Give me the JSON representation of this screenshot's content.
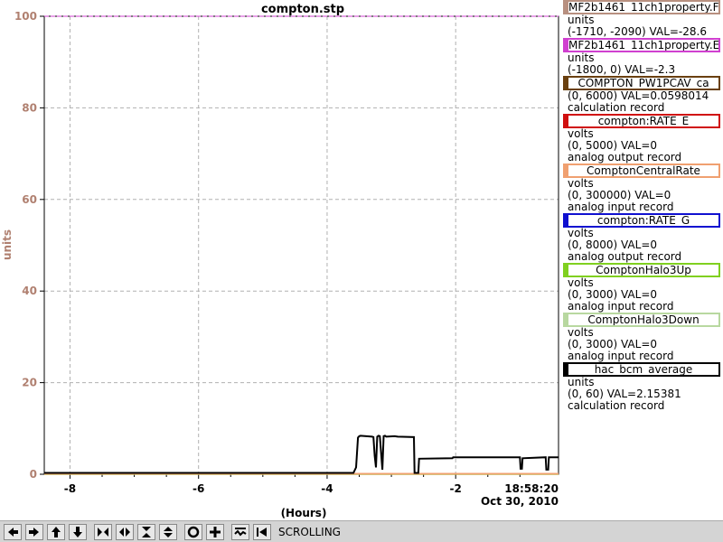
{
  "chart_data": {
    "type": "line",
    "title": "compton.stp",
    "xlabel": "(Hours)",
    "ylabel": "units",
    "xlim": [
      -8.4,
      -0.4
    ],
    "ylim": [
      0,
      100
    ],
    "x_ticks": [
      -8,
      -6,
      -4,
      -2
    ],
    "x_tick_labels": [
      "-8",
      "-6",
      "-4",
      "-2"
    ],
    "y_ticks": [
      0,
      20,
      40,
      60,
      80,
      100
    ],
    "y_tick_labels": [
      "0",
      "20",
      "40",
      "60",
      "80",
      "100"
    ],
    "grid": true,
    "timestamp_time": "18:58:20",
    "timestamp_date": "Oct 30, 2010",
    "series": [
      {
        "name": "hac_bcm_average",
        "color": "#000000",
        "x": [
          -8.4,
          -3.59,
          -3.55,
          -3.52,
          -3.5,
          -3.48,
          -3.3,
          -3.28,
          -3.26,
          -3.24,
          -3.22,
          -3.2,
          -3.18,
          -3.14,
          -3.12,
          -3.1,
          -3.08,
          -2.95,
          -2.9,
          -2.65,
          -2.64,
          -2.58,
          -2.57,
          -2.05,
          -2.04,
          -1.0,
          -0.99,
          -0.97,
          -0.96,
          -0.6,
          -0.59,
          -0.56,
          -0.55,
          -0.4
        ],
        "values": [
          0.3,
          0.3,
          1.5,
          8.0,
          8.3,
          8.4,
          8.2,
          8.1,
          4.0,
          1.5,
          8.2,
          8.4,
          8.3,
          1.0,
          8.3,
          8.4,
          8.2,
          8.3,
          8.2,
          8.1,
          0.3,
          0.3,
          3.4,
          3.5,
          3.7,
          3.7,
          1.2,
          1.2,
          3.5,
          3.7,
          1.0,
          1.0,
          3.7,
          3.7
        ]
      },
      {
        "name": "ComptonCentralRate",
        "color": "#f0a070",
        "x": [
          -8.4,
          -0.4
        ],
        "values": [
          0.1,
          0.1
        ]
      },
      {
        "name": "ComptonHalo3Up",
        "color": "#80d020",
        "x": [
          -8.4,
          -0.4
        ],
        "values": [
          0.05,
          0.05
        ]
      }
    ],
    "reference_line": {
      "value": 100,
      "color": "#d040d0"
    }
  },
  "legend": [
    {
      "name": "MF2b1461_11ch1property.F",
      "color": "#b89080",
      "lines": [
        "units",
        "(-1710, -2090) VAL=-28.6"
      ]
    },
    {
      "name": "MF2b1461_11ch1property.E",
      "color": "#d040d0",
      "lines": [
        "units",
        "(-1800, 0) VAL=-2.3"
      ]
    },
    {
      "name": "COMPTON_PW1PCAV_ca",
      "color": "#6a4010",
      "lines": [
        "(0, 6000) VAL=0.0598014",
        "calculation record"
      ]
    },
    {
      "name": "compton:RATE_E",
      "color": "#d01010",
      "lines": [
        "volts",
        "(0, 5000) VAL=0",
        "analog output record"
      ]
    },
    {
      "name": "ComptonCentralRate",
      "color": "#f0a070",
      "lines": [
        "volts",
        "(0, 300000) VAL=0",
        "analog input record"
      ]
    },
    {
      "name": "compton:RATE_G",
      "color": "#1010d0",
      "lines": [
        "volts",
        "(0, 8000) VAL=0",
        "analog output record"
      ]
    },
    {
      "name": "ComptonHalo3Up",
      "color": "#80d020",
      "lines": [
        "volts",
        "(0, 3000) VAL=0",
        "analog input record"
      ]
    },
    {
      "name": "ComptonHalo3Down",
      "color": "#b8d8a0",
      "lines": [
        "volts",
        "(0, 3000) VAL=0",
        "analog input record"
      ]
    },
    {
      "name": "hac_bcm_average",
      "color": "#000000",
      "lines": [
        "units",
        "(0, 60) VAL=2.15381",
        "calculation record"
      ]
    }
  ],
  "toolbar": {
    "buttons": [
      "pan-left-icon",
      "pan-right-icon",
      "pan-up-icon",
      "pan-down-icon",
      "zoom-in-x-icon",
      "zoom-out-x-icon",
      "zoom-in-y-icon",
      "zoom-out-y-icon",
      "auto-scale-icon",
      "reset-icon",
      "config-icon",
      "back-icon"
    ],
    "status": "SCROLLING"
  }
}
